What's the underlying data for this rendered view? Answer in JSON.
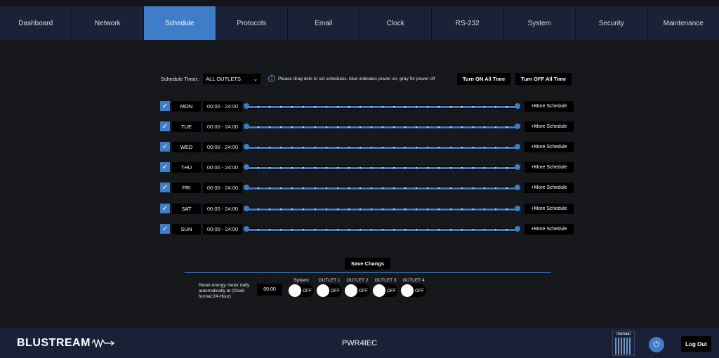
{
  "nav": {
    "tabs": [
      {
        "label": "Dashboard",
        "active": false
      },
      {
        "label": "Network",
        "active": false
      },
      {
        "label": "Schedule",
        "active": true
      },
      {
        "label": "Protocols",
        "active": false
      },
      {
        "label": "Email",
        "active": false
      },
      {
        "label": "Clock",
        "active": false
      },
      {
        "label": "RS-232",
        "active": false
      },
      {
        "label": "System",
        "active": false
      },
      {
        "label": "Security",
        "active": false
      },
      {
        "label": "Maintenance",
        "active": false
      }
    ]
  },
  "schedule": {
    "timer_label": "Schedule Timer:",
    "timer_value": "ALL OUTLETS",
    "info_text": "Please drag dots to set schedules, blue indicates power on, gray for power off",
    "turn_on_label": "Turn ON All Time",
    "turn_off_label": "Turn OFF All Time",
    "days": [
      {
        "day": "MON",
        "time": "00:00 - 24:00",
        "more": "+More Schedule",
        "checked": true
      },
      {
        "day": "TUE",
        "time": "00:00 - 24:00",
        "more": "+More Schedule",
        "checked": true
      },
      {
        "day": "WED",
        "time": "00:00 - 24:00",
        "more": "+More Schedule",
        "checked": true
      },
      {
        "day": "THU",
        "time": "00:00 - 24:00",
        "more": "+More Schedule",
        "checked": true
      },
      {
        "day": "FRI",
        "time": "00:00 - 24:00",
        "more": "+More Schedule",
        "checked": true
      },
      {
        "day": "SAT",
        "time": "00:00 - 24:00",
        "more": "+More Schedule",
        "checked": true
      },
      {
        "day": "SUN",
        "time": "00:00 - 24:00",
        "more": "+More Schedule",
        "checked": true
      }
    ],
    "save_label": "Save Changs"
  },
  "energy": {
    "reset_text": "Reset energy meter daily automatically at (Clock format:24-Hour)",
    "reset_time": "00:00",
    "toggles": [
      {
        "label": "System",
        "state": "OFF"
      },
      {
        "label": "OUTLET 1",
        "state": "OFF"
      },
      {
        "label": "OUTLET 2",
        "state": "OFF"
      },
      {
        "label": "OUTLET 3",
        "state": "OFF"
      },
      {
        "label": "OUTLET 4",
        "state": "OFF"
      }
    ]
  },
  "footer": {
    "logo_text": "BLUSTREAM",
    "device": "PWR4IEC",
    "manual_label": "manual",
    "logout_label": "Log Out"
  },
  "colors": {
    "accent": "#3f7dc8",
    "nav_bg": "#1a2136",
    "page_bg": "#16171b"
  },
  "icons": {
    "checkbox": "check-icon",
    "info": "info-icon",
    "select": "chevron-down-icon",
    "power": "power-icon",
    "qr": "qr-code-icon"
  }
}
